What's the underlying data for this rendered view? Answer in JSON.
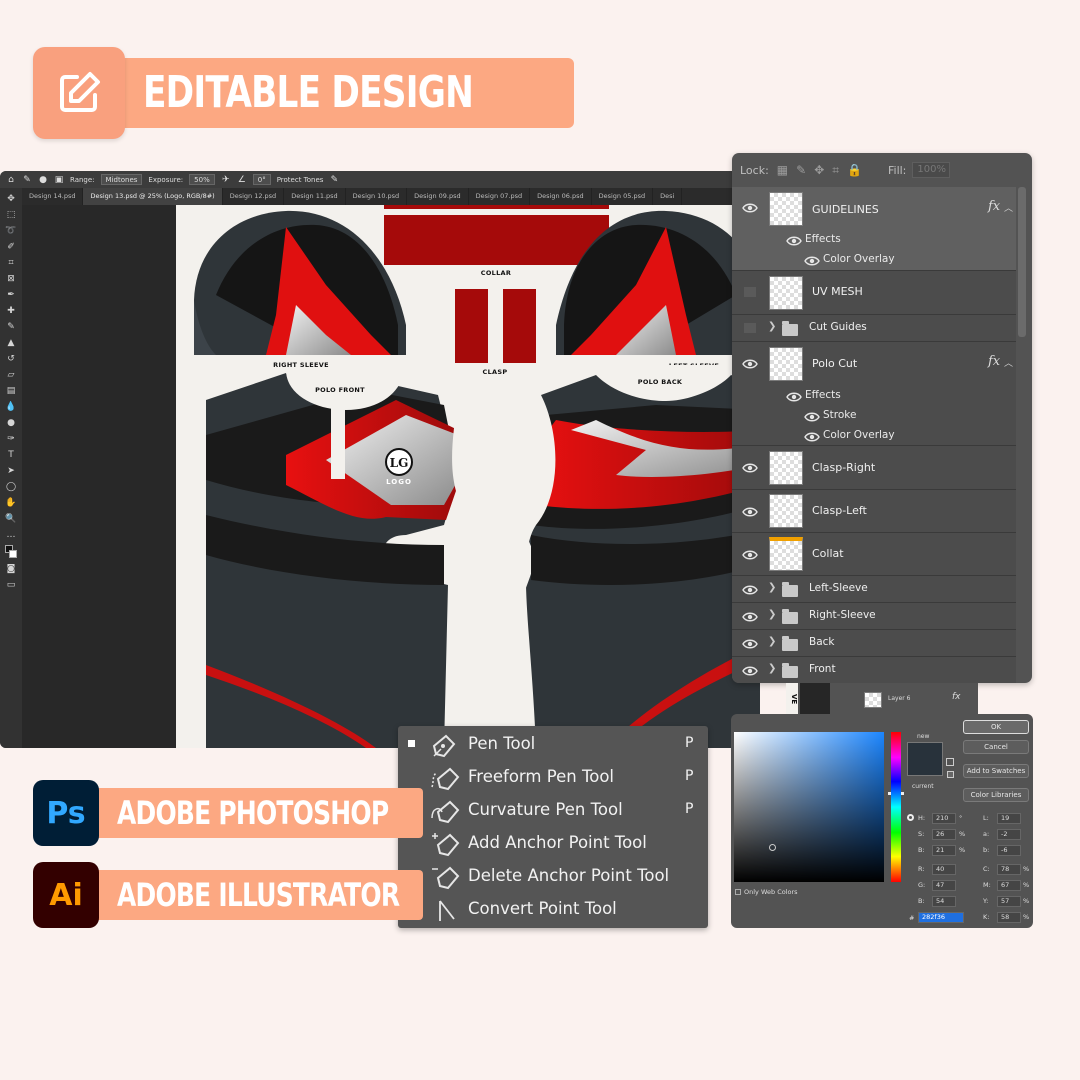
{
  "header": {
    "title": "EDITABLE DESIGN",
    "icon": "edit-icon"
  },
  "ps": {
    "options": {
      "range_label": "Range:",
      "range_value": "Midtones",
      "exposure_label": "Exposure:",
      "exposure_value": "50%",
      "angle_value": "0°",
      "protect_tones": "Protect Tones"
    },
    "tabs": [
      "Design 14.psd",
      "Design 13.psd @ 25% (Logo, RGB/8#)",
      "Design 12.psd",
      "Design 11.psd",
      "Design 10.psd",
      "Design 09.psd",
      "Design 07.psd",
      "Design 06.psd",
      "Design 05.psd",
      "Desi"
    ],
    "canvas": {
      "collar": "COLLAR",
      "right_sleeve": "RIGHT SLEEVE",
      "left_sleeve": "LEFT SLEEVE",
      "polo_front": "POLO FRONT",
      "polo_back": "POLO BACK",
      "clasp": "CLASP",
      "logo_mark": "LG",
      "logo_text": "LOGO",
      "edge_text": "VE"
    }
  },
  "layers": {
    "fill_label": "Fill:",
    "fill_value": "100%",
    "lock_label": "Lock:",
    "rows": {
      "guidelines": "GUIDELINES",
      "guidelines_effects": "Effects",
      "guidelines_color_overlay": "Color Overlay",
      "uv_mesh": "UV MESH",
      "cut_guides": "Cut Guides",
      "polo_cut": "Polo Cut",
      "polo_effects": "Effects",
      "polo_stroke": "Stroke",
      "polo_color_overlay": "Color Overlay",
      "clasp_right": "Clasp-Right",
      "clasp_left": "Clasp-Left",
      "collar": "Collat",
      "left_sleeve": "Left-Sleeve",
      "right_sleeve": "Right-Sleeve",
      "back": "Back",
      "front": "Front"
    },
    "fx": "fx",
    "strip_layer": "Layer 6"
  },
  "pen_menu": {
    "items": [
      {
        "label": "Pen Tool",
        "key": "P"
      },
      {
        "label": "Freeform Pen Tool",
        "key": "P"
      },
      {
        "label": "Curvature Pen Tool",
        "key": "P"
      },
      {
        "label": "Add Anchor Point Tool",
        "key": ""
      },
      {
        "label": "Delete Anchor Point Tool",
        "key": ""
      },
      {
        "label": "Convert Point Tool",
        "key": ""
      }
    ]
  },
  "color_picker": {
    "new_label": "new",
    "current_label": "current",
    "ok": "OK",
    "cancel": "Cancel",
    "add_swatches": "Add to Swatches",
    "color_libraries": "Color Libraries",
    "only_web": "Only Web Colors",
    "H": "210",
    "S": "26",
    "B": "21",
    "R": "40",
    "G": "47",
    "Bv": "54",
    "L": "19",
    "a": "-2",
    "b": "-6",
    "C": "78",
    "M": "67",
    "Y": "57",
    "K": "58",
    "hex": "282f36",
    "deg": "°",
    "pct": "%"
  },
  "apps": {
    "photoshop": {
      "icon": "Ps",
      "label": "ADOBE PHOTOSHOP"
    },
    "illustrator": {
      "icon": "Ai",
      "label": "ADOBE ILLUSTRATOR"
    }
  },
  "colors": {
    "accent": "#fca882",
    "red": "#e01010",
    "dark": "#2f3539",
    "panel": "#535353"
  }
}
